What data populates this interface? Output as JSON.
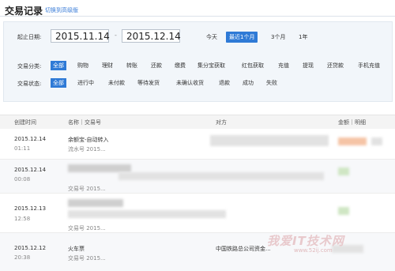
{
  "header": {
    "title": "交易记录",
    "switch_link": "切换到高级版"
  },
  "filter": {
    "date_label": "起止日期:",
    "start_date": "2015.11.14",
    "end_date": "2015.12.14",
    "range_sep": "-",
    "quick_ranges": [
      "今天",
      "最近1个月",
      "3个月",
      "1年"
    ],
    "category_label": "交易分类:",
    "categories": [
      "全部",
      "购物",
      "理财",
      "转账",
      "还款",
      "缴费",
      "集分宝获取",
      "红包获取",
      "充值",
      "提现",
      "还贷款",
      "手机充值"
    ],
    "status_label": "交易状态:",
    "statuses": [
      "全部",
      "进行中",
      "未付款",
      "等待发货",
      "未确认收货",
      "退款",
      "成功",
      "失败"
    ]
  },
  "table": {
    "headers": {
      "created": "创建时间",
      "name": "名称｜交易号",
      "party": "对方",
      "amount": "金额｜明细"
    },
    "rows": [
      {
        "date": "2015.12.14",
        "time": "01:11",
        "name": "余额宝-自动转入",
        "sub": "流水号 2015...",
        "party": ""
      },
      {
        "date": "2015.12.14",
        "time": "00:08",
        "name": "",
        "sub": "交易号 2015...",
        "party": ""
      },
      {
        "date": "2015.12.13",
        "time": "12:58",
        "name": "",
        "sub": "交易号 2015...",
        "party": ""
      },
      {
        "date": "2015.12.12",
        "time": "20:38",
        "name": "火车票",
        "sub": "交易号 2015...",
        "party": "中国铁路总公司资金..."
      }
    ]
  },
  "watermark": {
    "line1": "我爱IT技术网",
    "line2": "www.52ij.com"
  }
}
